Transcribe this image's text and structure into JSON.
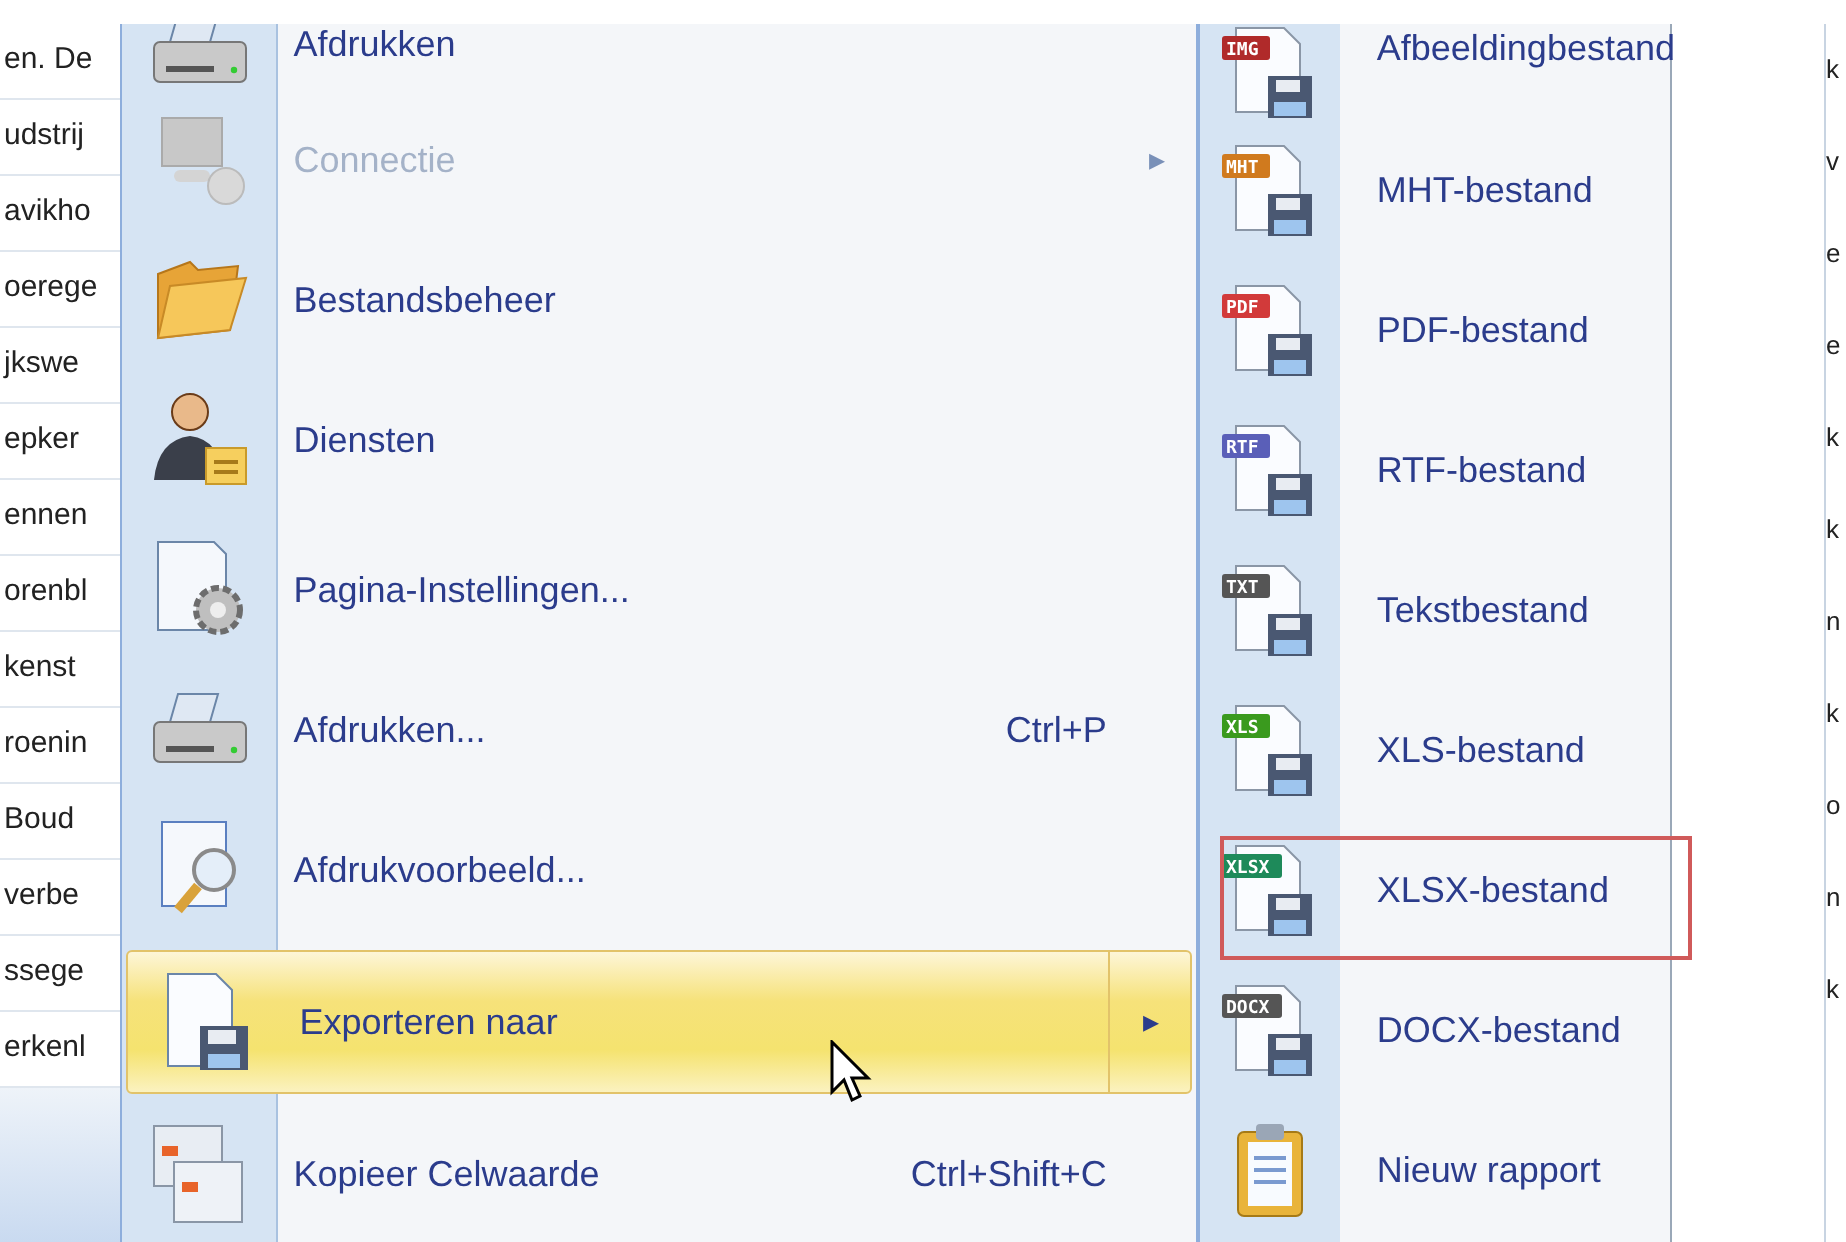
{
  "left_column": [
    "en. De",
    "udstrij",
    "avikho",
    "oerege",
    "jkswe",
    "epker",
    "ennen",
    "orenbl",
    "kenst",
    "roenin",
    "Boud",
    "verbe",
    "ssege",
    "erkenl"
  ],
  "menu": [
    {
      "kind": "item",
      "label": "Afdrukken",
      "disabled": false,
      "selected": false
    },
    {
      "kind": "item",
      "label": "Connectie",
      "disabled": true,
      "selected": false,
      "submenu_arrow": "▸"
    },
    {
      "kind": "item",
      "label": "Bestandsbeheer",
      "disabled": false,
      "selected": false
    },
    {
      "kind": "item",
      "label": "Diensten",
      "disabled": false,
      "selected": false
    },
    {
      "kind": "separator"
    },
    {
      "kind": "item",
      "label": "Pagina-Instellingen...",
      "disabled": false,
      "selected": false
    },
    {
      "kind": "item",
      "label": "Afdrukken...",
      "shortcut": "Ctrl+P",
      "disabled": false,
      "selected": false
    },
    {
      "kind": "item",
      "label": "Afdrukvoorbeeld...",
      "disabled": false,
      "selected": false
    },
    {
      "kind": "separator"
    },
    {
      "kind": "item",
      "label": "Exporteren naar",
      "disabled": false,
      "selected": true,
      "submenu_arrow": "▸"
    },
    {
      "kind": "separator"
    },
    {
      "kind": "item",
      "label": "Kopieer Celwaarde",
      "shortcut": "Ctrl+Shift+C",
      "disabled": false,
      "selected": false
    }
  ],
  "submenu": [
    {
      "kind": "file",
      "badge": "IMG",
      "color": "#b02a2a",
      "label": "Afbeeldingbestand",
      "highlighted": false
    },
    {
      "kind": "file",
      "badge": "MHT",
      "color": "#d07a1e",
      "label": "MHT-bestand",
      "highlighted": false
    },
    {
      "kind": "file",
      "badge": "PDF",
      "color": "#d23a3a",
      "label": "PDF-bestand",
      "highlighted": false
    },
    {
      "kind": "file",
      "badge": "RTF",
      "color": "#5a5fb8",
      "label": "RTF-bestand",
      "highlighted": false
    },
    {
      "kind": "file",
      "badge": "TXT",
      "color": "#555555",
      "label": "Tekstbestand",
      "highlighted": false
    },
    {
      "kind": "file",
      "badge": "XLS",
      "color": "#3a9a1e",
      "label": "XLS-bestand",
      "highlighted": false
    },
    {
      "kind": "file",
      "badge": "XLSX",
      "color": "#1e8a5a",
      "label": "XLSX-bestand",
      "highlighted": true
    },
    {
      "kind": "file",
      "badge": "DOCX",
      "color": "#555555",
      "label": "DOCX-bestand",
      "highlighted": false
    },
    {
      "kind": "report",
      "label": "Nieuw rapport",
      "highlighted": false
    }
  ],
  "right_column": [
    "k",
    "v",
    "e",
    "e",
    "k",
    "k",
    "n",
    "k",
    "o",
    "n",
    "k"
  ]
}
